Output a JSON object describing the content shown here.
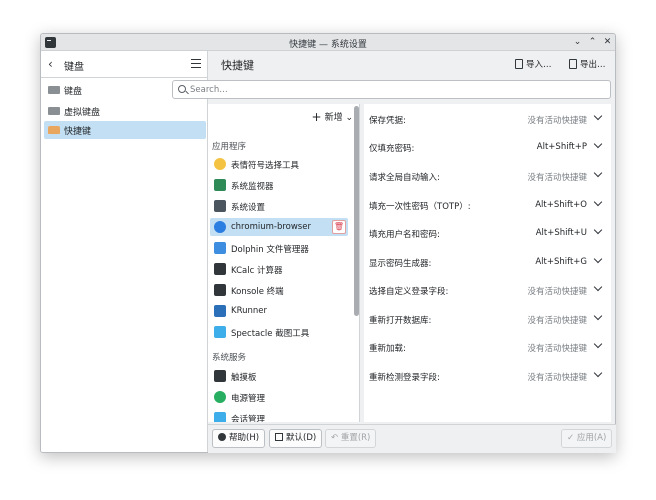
{
  "window": {
    "title": "快捷键 — 系统设置"
  },
  "sidebar": {
    "title": "键盘",
    "items": [
      {
        "label": "键盘",
        "icon": "keyboard-icon"
      },
      {
        "label": "虚拟键盘",
        "icon": "virtual-keyboard-icon"
      },
      {
        "label": "快捷键",
        "icon": "shortcuts-icon",
        "active": true
      }
    ]
  },
  "header": {
    "title": "快捷键",
    "import_label": "导入…",
    "export_label": "导出…"
  },
  "search": {
    "placeholder": "Search…"
  },
  "list": {
    "add_label": "新增",
    "group_apps": "应用程序",
    "apps": [
      {
        "label": "表情符号选择工具",
        "color": "#f5c342"
      },
      {
        "label": "系统监视器",
        "color": "#2e8b57"
      },
      {
        "label": "系统设置",
        "color": "#4a5560"
      },
      {
        "label": "chromium-browser",
        "color": "#2a7de1",
        "selected": true
      },
      {
        "label": "Dolphin 文件管理器",
        "color": "#3d8ee0"
      },
      {
        "label": "KCalc 计算器",
        "color": "#31363b"
      },
      {
        "label": "Konsole 终端",
        "color": "#31363b"
      },
      {
        "label": "KRunner",
        "color": "#2a6fb8"
      },
      {
        "label": "Spectacle 截图工具",
        "color": "#3daee9"
      }
    ],
    "group_services": "系统服务",
    "services": [
      {
        "label": "触摸板",
        "color": "#31363b"
      },
      {
        "label": "电源管理",
        "color": "#27ae60"
      },
      {
        "label": "会话管理",
        "color": "#3daee9"
      }
    ]
  },
  "shortcuts": [
    {
      "label": "保存凭据:",
      "value": "没有活动快捷键",
      "none": true
    },
    {
      "label": "仅填充密码:",
      "value": "Alt+Shift+P",
      "none": false
    },
    {
      "label": "请求全局自动输入:",
      "value": "没有活动快捷键",
      "none": true
    },
    {
      "label": "填充一次性密码（TOTP）:",
      "value": "Alt+Shift+O",
      "none": false
    },
    {
      "label": "填充用户名和密码:",
      "value": "Alt+Shift+U",
      "none": false
    },
    {
      "label": "显示密码生成器:",
      "value": "Alt+Shift+G",
      "none": false
    },
    {
      "label": "选择自定义登录字段:",
      "value": "没有活动快捷键",
      "none": true
    },
    {
      "label": "重新打开数据库:",
      "value": "没有活动快捷键",
      "none": true
    },
    {
      "label": "重新加载:",
      "value": "没有活动快捷键",
      "none": true
    },
    {
      "label": "重新检测登录字段:",
      "value": "没有活动快捷键",
      "none": true
    }
  ],
  "footer": {
    "help_label": "帮助(H)",
    "defaults_label": "默认(D)",
    "reset_label": "重置(R)",
    "apply_label": "应用(A)"
  }
}
